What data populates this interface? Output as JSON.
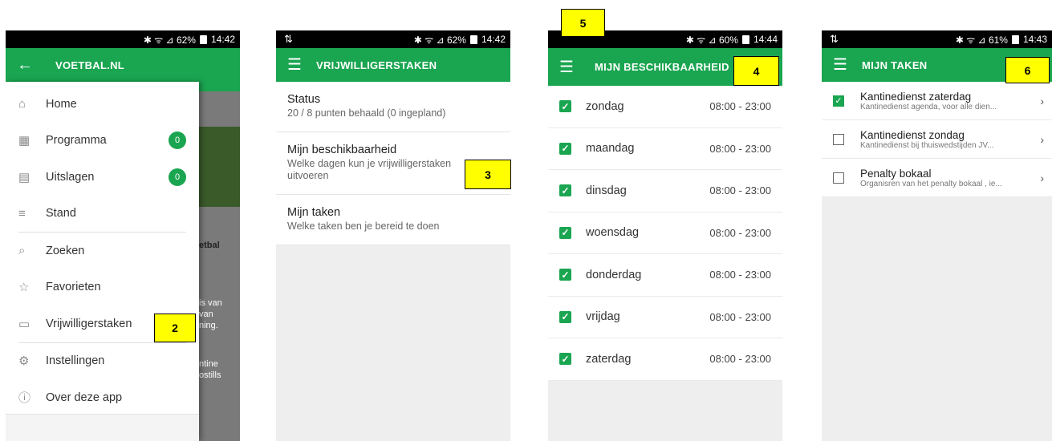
{
  "colors": {
    "brand_green": "#1aa550",
    "callout_yellow": "#ffff00"
  },
  "phone1": {
    "status": {
      "signal": "✱ ᯤ ⊿ 62%",
      "time": "14:42"
    },
    "appbar": {
      "back_icon": "←",
      "title": "VOETBAL.NL"
    },
    "drawer": [
      {
        "icon": "⌂",
        "label": "Home"
      },
      {
        "icon": "▦",
        "label": "Programma",
        "badge": "0"
      },
      {
        "icon": "▤",
        "label": "Uitslagen",
        "badge": "0"
      },
      {
        "icon": "≡",
        "label": "Stand"
      },
      {
        "icon": "⌕",
        "label": "Zoeken"
      },
      {
        "icon": "☆",
        "label": "Favorieten"
      },
      {
        "icon": "▭",
        "label": "Vrijwilligerstaken"
      },
      {
        "icon": "⚙",
        "label": "Instellingen"
      },
      {
        "icon": "ⓘ",
        "label": "Over deze app"
      }
    ],
    "behind": {
      "t1": "etbal",
      "t2": "is van",
      "t3": "van",
      "t4": "ning.",
      "t5": "ntine",
      "t6": "ostills"
    }
  },
  "phone2": {
    "status": {
      "left": "⇅",
      "signal": "✱ ᯤ ⊿ 62%",
      "time": "14:42"
    },
    "appbar": {
      "title": "VRIJWILLIGERSTAKEN"
    },
    "rows": [
      {
        "title": "Status",
        "sub": "20 / 8 punten behaald (0 ingepland)"
      },
      {
        "title": "Mijn beschikbaarheid",
        "sub": "Welke dagen kun je vrijwilligerstaken uitvoeren"
      },
      {
        "title": "Mijn taken",
        "sub": "Welke taken ben je bereid te doen"
      }
    ]
  },
  "phone3": {
    "status": {
      "signal": "✱ ᯤ ⊿ 60%",
      "time": "14:44"
    },
    "appbar": {
      "title": "MIJN BESCHIKBAARHEID"
    },
    "days": [
      {
        "day": "zondag",
        "time": "08:00  -  23:00"
      },
      {
        "day": "maandag",
        "time": "08:00  -  23:00"
      },
      {
        "day": "dinsdag",
        "time": "08:00  -  23:00"
      },
      {
        "day": "woensdag",
        "time": "08:00  -  23:00"
      },
      {
        "day": "donderdag",
        "time": "08:00  -  23:00"
      },
      {
        "day": "vrijdag",
        "time": "08:00  -  23:00"
      },
      {
        "day": "zaterdag",
        "time": "08:00  -  23:00"
      }
    ]
  },
  "phone4": {
    "status": {
      "left": "⇅",
      "signal": "✱ ᯤ ⊿ 61%",
      "time": "14:43"
    },
    "appbar": {
      "title": "MIJN TAKEN"
    },
    "tasks": [
      {
        "title": "Kantinedienst zaterdag",
        "sub": "Kantinedienst agenda, voor alle dien...",
        "checked": true
      },
      {
        "title": "Kantinedienst zondag",
        "sub": "Kantinedienst bij thuiswedstijden JV...",
        "checked": false
      },
      {
        "title": "Penalty bokaal",
        "sub": "Organisren van het penalty bokaal , ie...",
        "checked": false
      }
    ]
  },
  "callouts": {
    "c2": "2",
    "c3": "3",
    "c4": "4",
    "c5": "5",
    "c6": "6"
  }
}
